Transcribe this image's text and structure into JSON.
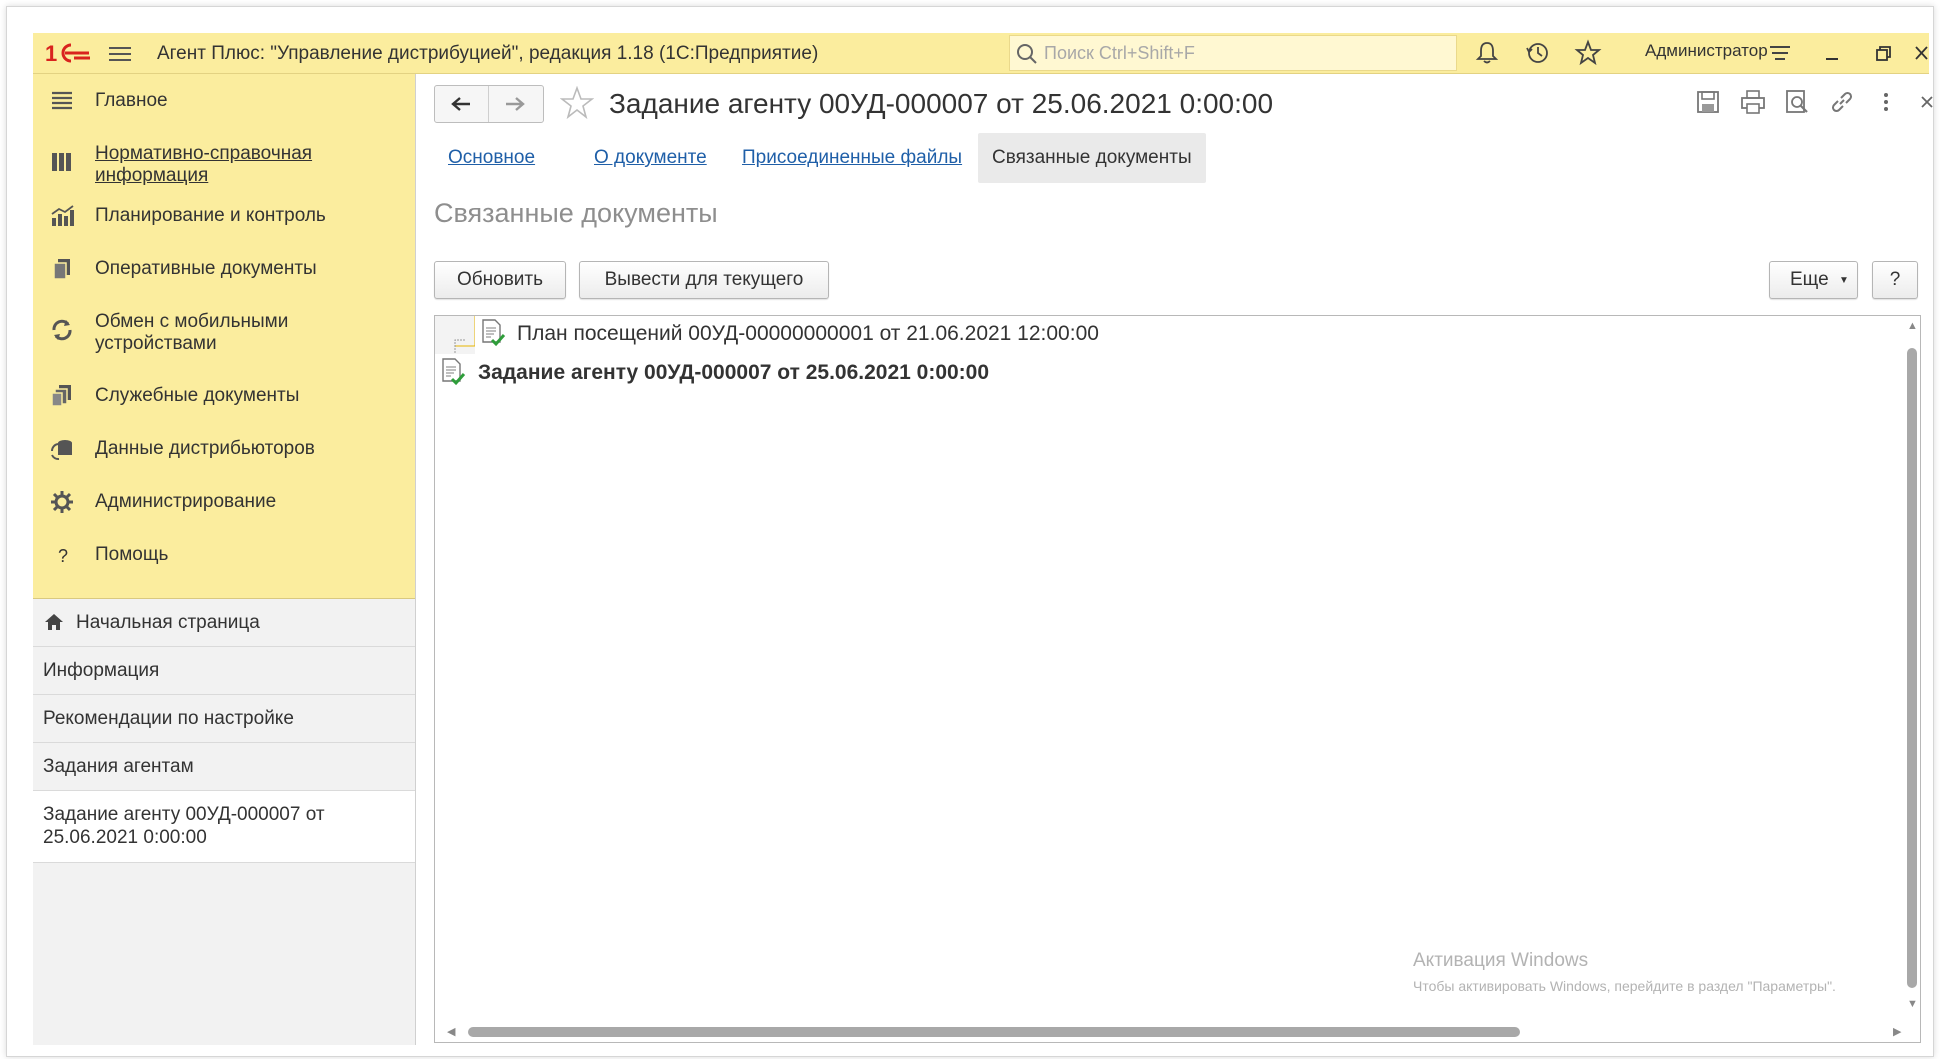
{
  "titlebar": {
    "app_title": "Агент Плюс: \"Управление дистрибуцией\", редакция 1.18  (1С:Предприятие)",
    "search_placeholder": "Поиск Ctrl+Shift+F",
    "user": "Администратор"
  },
  "sidebar": {
    "sections": [
      {
        "label": "Главное",
        "icon": "list-icon"
      },
      {
        "label": "Нормативно-справочная информация",
        "icon": "book-icon"
      },
      {
        "label": "Планирование и контроль",
        "icon": "chart-icon"
      },
      {
        "label": "Оперативные документы",
        "icon": "documents-icon"
      },
      {
        "label": "Обмен с мобильными устройствами",
        "icon": "sync-icon"
      },
      {
        "label": "Служебные документы",
        "icon": "service-docs-icon"
      },
      {
        "label": "Данные дистрибьюторов",
        "icon": "distributors-icon"
      },
      {
        "label": "Администрирование",
        "icon": "gear-icon"
      },
      {
        "label": "Помощь",
        "icon": "help-icon"
      }
    ],
    "open_windows": [
      {
        "label": "Начальная страница",
        "icon": "home-icon"
      },
      {
        "label": "Информация"
      },
      {
        "label": "Рекомендации по настройке"
      },
      {
        "label": "Задания агентам"
      },
      {
        "label": "Задание агенту 00УД-000007 от 25.06.2021 0:00:00"
      }
    ]
  },
  "document": {
    "title": "Задание агенту 00УД-000007 от 25.06.2021 0:00:00",
    "tabs": [
      {
        "label": "Основное"
      },
      {
        "label": "О документе"
      },
      {
        "label": "Присоединенные файлы"
      },
      {
        "label": "Связанные документы"
      }
    ],
    "section_title": "Связанные документы",
    "buttons": {
      "refresh": "Обновить",
      "show_current": "Вывести для текущего",
      "more": "Еще",
      "help": "?"
    },
    "tree": [
      {
        "text": "План посещений 00УД-00000000001 от 21.06.2021 12:00:00",
        "current": false
      },
      {
        "text": "Задание агенту 00УД-000007 от 25.06.2021 0:00:00",
        "current": true
      }
    ]
  },
  "watermark": {
    "line1": "Активация Windows",
    "line2": "Чтобы активировать Windows, перейдите в раздел \"Параметры\"."
  },
  "colors": {
    "title_bar": "#fbed9e",
    "sections_panel": "#fbed9e",
    "link": "#1f5fa8",
    "logo_red": "#d9231e"
  }
}
